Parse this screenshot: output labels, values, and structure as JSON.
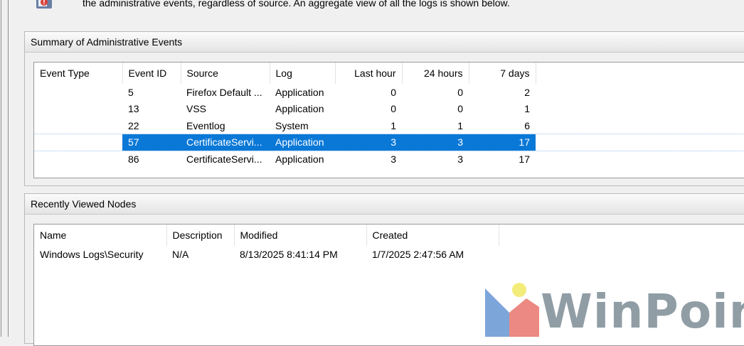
{
  "intro": {
    "text": "the administrative events, regardless of source. An aggregate view of all the logs is shown below."
  },
  "summary": {
    "title": "Summary of Administrative Events",
    "columns": [
      "Event Type",
      "Event ID",
      "Source",
      "Log",
      "Last hour",
      "24 hours",
      "7 days"
    ],
    "rows": [
      {
        "type": "",
        "id": "5",
        "source": "Firefox Default ...",
        "log": "Application",
        "last_hour": "0",
        "h24": "0",
        "d7": "2"
      },
      {
        "type": "",
        "id": "13",
        "source": "VSS",
        "log": "Application",
        "last_hour": "0",
        "h24": "0",
        "d7": "1"
      },
      {
        "type": "",
        "id": "22",
        "source": "Eventlog",
        "log": "System",
        "last_hour": "1",
        "h24": "1",
        "d7": "6"
      },
      {
        "type": "",
        "id": "57",
        "source": "CertificateServi...",
        "log": "Application",
        "last_hour": "3",
        "h24": "3",
        "d7": "17"
      },
      {
        "type": "",
        "id": "86",
        "source": "CertificateServi...",
        "log": "Application",
        "last_hour": "3",
        "h24": "3",
        "d7": "17"
      }
    ],
    "selected_row": 3
  },
  "recent": {
    "title": "Recently Viewed Nodes",
    "columns": [
      "Name",
      "Description",
      "Modified",
      "Created"
    ],
    "rows": [
      {
        "name": "Windows Logs\\Security",
        "description": "N/A",
        "modified": "8/13/2025 8:41:14 PM",
        "created": "1/7/2025 2:47:56 AM"
      }
    ]
  },
  "watermark": {
    "text": "WinPoin"
  },
  "colors": {
    "selection": "#0a78d7",
    "header_border": "#b9b9b9"
  },
  "icons": {
    "intro": "event-viewer-icon"
  }
}
